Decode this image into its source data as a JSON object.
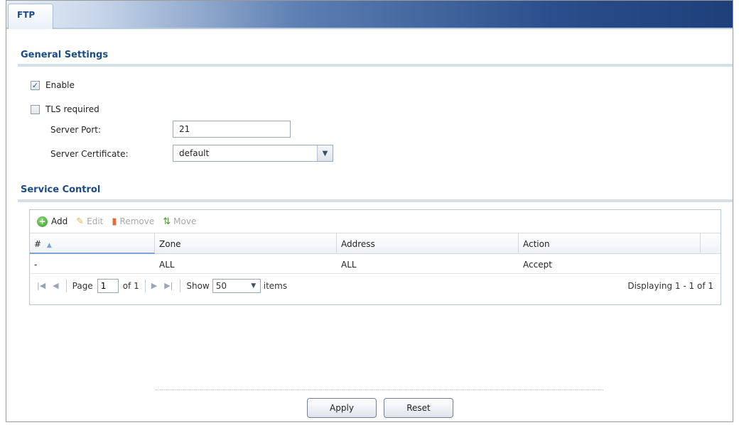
{
  "tabs": [
    {
      "label": "FTP",
      "active": true
    }
  ],
  "general": {
    "title": "General Settings",
    "enable": {
      "label": "Enable",
      "checked": true
    },
    "tls": {
      "label": "TLS required",
      "checked": false
    },
    "server_port": {
      "label": "Server Port:",
      "value": "21"
    },
    "server_certificate": {
      "label": "Server Certificate:",
      "value": "default"
    }
  },
  "service_control": {
    "title": "Service Control",
    "toolbar": {
      "add": "Add",
      "edit": "Edit",
      "remove": "Remove",
      "move": "Move"
    },
    "columns": [
      "#",
      "Zone",
      "Address",
      "Action"
    ],
    "rows": [
      {
        "num": "-",
        "zone": "ALL",
        "address": "ALL",
        "action": "Accept"
      }
    ],
    "pager": {
      "page_label": "Page",
      "page_value": "1",
      "of_label": "of 1",
      "show_label": "Show",
      "show_value": "50",
      "items_label": "items",
      "display_text": "Displaying 1 - 1 of 1"
    }
  },
  "buttons": {
    "apply": "Apply",
    "reset": "Reset"
  },
  "colors": {
    "accent": "#1c4c86",
    "tab_bar_dark": "#1e3f7a",
    "add_green": "#3a9a2a"
  }
}
